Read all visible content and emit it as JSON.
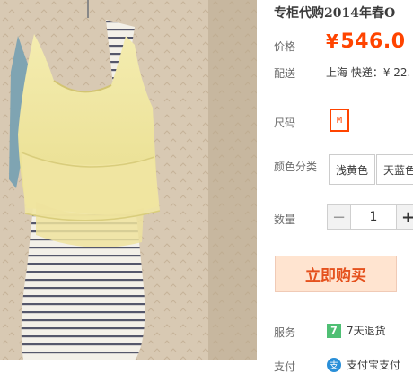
{
  "product": {
    "title": "专柜代购2014年春O",
    "image_alt": "sleeveless layered yellow top with striped dress",
    "price_label": "价格",
    "currency": "¥",
    "price": "546.0",
    "shipping_label": "配送",
    "shipping_text": "上海 快递：¥ 22."
  },
  "size": {
    "label": "尺码",
    "selected": "M"
  },
  "color": {
    "label": "颜色分类",
    "options": [
      "浅黄色",
      "天蓝色"
    ]
  },
  "quantity": {
    "label": "数量",
    "value": "1",
    "minus": "−",
    "plus": "+"
  },
  "buy_button": "立即购买",
  "services": {
    "label": "服务",
    "badge": "7",
    "text": "7天退货"
  },
  "payment": {
    "label": "支付",
    "icon_text": "支",
    "text": "支付宝支付"
  },
  "colors": {
    "accent": "#ff4400",
    "buy_bg": "#ffe4d0",
    "badge_green": "#4fbf74",
    "alipay_blue": "#2a8fd8"
  }
}
